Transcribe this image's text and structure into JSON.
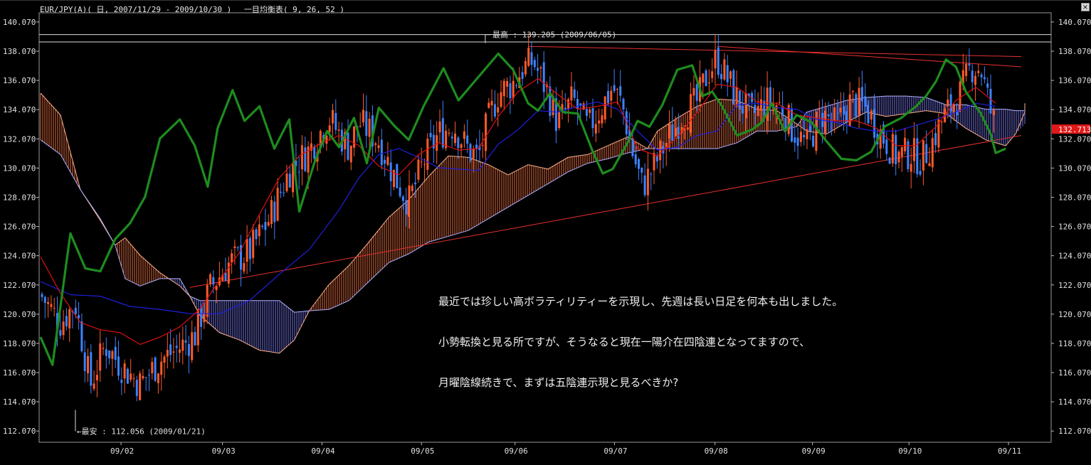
{
  "window": {
    "title": "EUR/JPY(A)( 日, 2007/11/29 - 2009/10/30 )　 一目均衡表( 9, 26, 52 )",
    "close_label": "×"
  },
  "chart_data": {
    "type": "candlestick",
    "symbol": "EUR/JPY(A)",
    "timeframe": "日",
    "period": "2007/11/29 - 2009/10/30",
    "indicator": "一目均衡表( 9, 26, 52 )",
    "ylim": [
      111.4,
      140.6
    ],
    "y_ticks": [
      "140.070",
      "138.070",
      "136.070",
      "134.070",
      "132.070",
      "130.070",
      "128.070",
      "126.070",
      "124.070",
      "122.070",
      "120.070",
      "118.070",
      "116.070",
      "114.070",
      "112.070"
    ],
    "x_ticks": [
      "09/02",
      "09/03",
      "09/04",
      "09/05",
      "09/06",
      "09/07",
      "09/08",
      "09/09",
      "09/10",
      "09/11"
    ],
    "x_tick_positions": [
      0.088,
      0.19,
      0.29,
      0.39,
      0.484,
      0.584,
      0.685,
      0.783,
      0.88,
      0.98
    ],
    "current_price": "132.713",
    "high_label": "最高 : 139.205 (2009/06/05)",
    "low_label": "最安 : 112.056 (2009/01/21)",
    "colors": {
      "up_candle": "#ff5a28",
      "down_candle": "#3c82ff",
      "chikou": "#1e8c1e",
      "kijun": "#2020e0",
      "tenkan": "#e01010",
      "cloud_bull": "#ff7a4a",
      "cloud_bear": "#8080ff",
      "trendline": "#e83030",
      "hline": "#dddddd",
      "price_tag": "#e01818"
    },
    "horizontal_lines": [
      139.205,
      138.7
    ],
    "trendlines": [
      {
        "from": [
          0.15,
          121.9
        ],
        "to": [
          1.0,
          132.3
        ]
      },
      {
        "from": [
          0.49,
          138.4
        ],
        "to": [
          1.0,
          137.7
        ]
      },
      {
        "from": [
          0.68,
          138.4
        ],
        "to": [
          1.0,
          137.0
        ]
      }
    ],
    "candle_points": [
      [
        0.0,
        121.4
      ],
      [
        0.02,
        119.5
      ],
      [
        0.035,
        120.8
      ],
      [
        0.05,
        115.2
      ],
      [
        0.065,
        118.0
      ],
      [
        0.08,
        116.6
      ],
      [
        0.1,
        115.3
      ],
      [
        0.12,
        116.9
      ],
      [
        0.14,
        117.8
      ],
      [
        0.155,
        118.6
      ],
      [
        0.17,
        121.8
      ],
      [
        0.19,
        123.6
      ],
      [
        0.21,
        124.3
      ],
      [
        0.23,
        126.6
      ],
      [
        0.25,
        129.9
      ],
      [
        0.27,
        131.3
      ],
      [
        0.29,
        133.5
      ],
      [
        0.3,
        132.4
      ],
      [
        0.31,
        131.5
      ],
      [
        0.32,
        133.2
      ],
      [
        0.33,
        132.6
      ],
      [
        0.34,
        131.9
      ],
      [
        0.355,
        129.6
      ],
      [
        0.37,
        127.7
      ],
      [
        0.385,
        130.5
      ],
      [
        0.4,
        132.4
      ],
      [
        0.415,
        133.0
      ],
      [
        0.43,
        131.3
      ],
      [
        0.44,
        130.8
      ],
      [
        0.45,
        133.3
      ],
      [
        0.46,
        135.2
      ],
      [
        0.475,
        135.9
      ],
      [
        0.485,
        136.9
      ],
      [
        0.495,
        137.4
      ],
      [
        0.51,
        135.2
      ],
      [
        0.52,
        133.1
      ],
      [
        0.535,
        134.8
      ],
      [
        0.55,
        132.8
      ],
      [
        0.56,
        133.8
      ],
      [
        0.575,
        135.6
      ],
      [
        0.585,
        134.3
      ],
      [
        0.595,
        131.1
      ],
      [
        0.605,
        128.8
      ],
      [
        0.615,
        130.0
      ],
      [
        0.63,
        132.0
      ],
      [
        0.645,
        133.7
      ],
      [
        0.66,
        134.6
      ],
      [
        0.67,
        136.5
      ],
      [
        0.68,
        137.6
      ],
      [
        0.69,
        136.2
      ],
      [
        0.7,
        134.8
      ],
      [
        0.715,
        133.6
      ],
      [
        0.73,
        134.6
      ],
      [
        0.745,
        134.3
      ],
      [
        0.755,
        132.8
      ],
      [
        0.77,
        131.6
      ],
      [
        0.785,
        133.8
      ],
      [
        0.8,
        133.0
      ],
      [
        0.815,
        134.7
      ],
      [
        0.83,
        134.1
      ],
      [
        0.845,
        132.4
      ],
      [
        0.86,
        130.9
      ],
      [
        0.875,
        131.1
      ],
      [
        0.885,
        130.6
      ],
      [
        0.895,
        131.7
      ],
      [
        0.905,
        133.2
      ],
      [
        0.915,
        134.3
      ],
      [
        0.925,
        135.2
      ],
      [
        0.935,
        137.0
      ],
      [
        0.945,
        136.9
      ],
      [
        0.955,
        133.9
      ],
      [
        0.96,
        132.9
      ]
    ],
    "chikou_points": [
      [
        0.0,
        118.5
      ],
      [
        0.012,
        116.6
      ],
      [
        0.03,
        125.6
      ],
      [
        0.045,
        123.2
      ],
      [
        0.06,
        123.0
      ],
      [
        0.075,
        125.2
      ],
      [
        0.09,
        126.3
      ],
      [
        0.105,
        128.1
      ],
      [
        0.12,
        132.1
      ],
      [
        0.14,
        133.4
      ],
      [
        0.155,
        131.6
      ],
      [
        0.168,
        128.8
      ],
      [
        0.178,
        132.8
      ],
      [
        0.193,
        135.4
      ],
      [
        0.205,
        133.3
      ],
      [
        0.22,
        134.3
      ],
      [
        0.235,
        131.4
      ],
      [
        0.25,
        133.4
      ],
      [
        0.26,
        127.1
      ],
      [
        0.275,
        130.4
      ],
      [
        0.288,
        132.6
      ],
      [
        0.3,
        131.5
      ],
      [
        0.315,
        133.5
      ],
      [
        0.328,
        130.4
      ],
      [
        0.34,
        134.2
      ],
      [
        0.355,
        133.0
      ],
      [
        0.37,
        132.0
      ],
      [
        0.385,
        134.3
      ],
      [
        0.405,
        136.9
      ],
      [
        0.42,
        134.7
      ],
      [
        0.44,
        136.3
      ],
      [
        0.46,
        137.9
      ],
      [
        0.475,
        136.8
      ],
      [
        0.49,
        134.5
      ],
      [
        0.5,
        134.0
      ],
      [
        0.512,
        135.2
      ],
      [
        0.525,
        133.9
      ],
      [
        0.54,
        133.8
      ],
      [
        0.555,
        131.2
      ],
      [
        0.565,
        129.7
      ],
      [
        0.575,
        130.0
      ],
      [
        0.59,
        131.8
      ],
      [
        0.6,
        133.3
      ],
      [
        0.612,
        132.9
      ],
      [
        0.625,
        134.4
      ],
      [
        0.64,
        136.8
      ],
      [
        0.655,
        137.1
      ],
      [
        0.665,
        135.0
      ],
      [
        0.675,
        135.3
      ],
      [
        0.685,
        134.3
      ],
      [
        0.7,
        132.3
      ],
      [
        0.715,
        132.7
      ],
      [
        0.725,
        133.2
      ],
      [
        0.735,
        134.5
      ],
      [
        0.748,
        132.6
      ],
      [
        0.76,
        133.7
      ],
      [
        0.775,
        133.2
      ],
      [
        0.79,
        131.9
      ],
      [
        0.805,
        130.7
      ],
      [
        0.82,
        130.6
      ],
      [
        0.835,
        131.2
      ],
      [
        0.848,
        132.9
      ],
      [
        0.865,
        133.5
      ],
      [
        0.88,
        134.3
      ],
      [
        0.89,
        135.0
      ],
      [
        0.9,
        136.0
      ],
      [
        0.91,
        137.5
      ],
      [
        0.92,
        137.0
      ],
      [
        0.93,
        135.3
      ],
      [
        0.945,
        133.8
      ],
      [
        0.955,
        132.4
      ],
      [
        0.96,
        131.1
      ],
      [
        0.97,
        131.4
      ]
    ],
    "kijun_points": [
      [
        0.0,
        122.3
      ],
      [
        0.03,
        121.4
      ],
      [
        0.06,
        121.3
      ],
      [
        0.09,
        120.6
      ],
      [
        0.12,
        120.4
      ],
      [
        0.15,
        120.1
      ],
      [
        0.18,
        120.1
      ],
      [
        0.21,
        121.0
      ],
      [
        0.24,
        122.8
      ],
      [
        0.27,
        124.5
      ],
      [
        0.3,
        127.2
      ],
      [
        0.32,
        129.4
      ],
      [
        0.34,
        131.0
      ],
      [
        0.36,
        131.4
      ],
      [
        0.38,
        130.8
      ],
      [
        0.4,
        130.1
      ],
      [
        0.42,
        130.0
      ],
      [
        0.44,
        129.9
      ],
      [
        0.46,
        131.7
      ],
      [
        0.48,
        132.7
      ],
      [
        0.5,
        134.0
      ],
      [
        0.52,
        133.9
      ],
      [
        0.54,
        134.3
      ],
      [
        0.56,
        134.6
      ],
      [
        0.58,
        134.1
      ],
      [
        0.6,
        132.6
      ],
      [
        0.62,
        131.3
      ],
      [
        0.64,
        131.5
      ],
      [
        0.66,
        132.3
      ],
      [
        0.68,
        132.6
      ],
      [
        0.7,
        134.4
      ],
      [
        0.72,
        134.5
      ],
      [
        0.74,
        134.2
      ],
      [
        0.76,
        134.1
      ],
      [
        0.78,
        133.4
      ],
      [
        0.8,
        133.2
      ],
      [
        0.82,
        132.8
      ],
      [
        0.84,
        132.6
      ],
      [
        0.86,
        132.6
      ],
      [
        0.88,
        133.0
      ],
      [
        0.9,
        133.4
      ],
      [
        0.92,
        133.9
      ],
      [
        0.94,
        134.5
      ],
      [
        0.96,
        134.3
      ]
    ],
    "tenkan_points": [
      [
        0.0,
        124.0
      ],
      [
        0.02,
        121.5
      ],
      [
        0.04,
        119.5
      ],
      [
        0.06,
        119.0
      ],
      [
        0.08,
        118.8
      ],
      [
        0.1,
        118.0
      ],
      [
        0.12,
        118.5
      ],
      [
        0.14,
        119.2
      ],
      [
        0.16,
        120.4
      ],
      [
        0.18,
        122.4
      ],
      [
        0.2,
        124.3
      ],
      [
        0.22,
        126.9
      ],
      [
        0.24,
        129.4
      ],
      [
        0.26,
        130.9
      ],
      [
        0.28,
        131.7
      ],
      [
        0.3,
        132.3
      ],
      [
        0.32,
        131.6
      ],
      [
        0.34,
        130.2
      ],
      [
        0.36,
        129.6
      ],
      [
        0.38,
        131.0
      ],
      [
        0.4,
        131.8
      ],
      [
        0.42,
        131.3
      ],
      [
        0.44,
        131.4
      ],
      [
        0.46,
        133.6
      ],
      [
        0.48,
        135.3
      ],
      [
        0.5,
        136.2
      ],
      [
        0.52,
        135.1
      ],
      [
        0.54,
        134.1
      ],
      [
        0.56,
        134.3
      ],
      [
        0.58,
        134.6
      ],
      [
        0.6,
        131.4
      ],
      [
        0.62,
        130.9
      ],
      [
        0.64,
        132.2
      ],
      [
        0.66,
        133.9
      ],
      [
        0.68,
        135.8
      ],
      [
        0.7,
        135.6
      ],
      [
        0.72,
        134.6
      ],
      [
        0.74,
        134.5
      ],
      [
        0.76,
        133.7
      ],
      [
        0.78,
        133.5
      ],
      [
        0.8,
        133.3
      ],
      [
        0.82,
        133.3
      ],
      [
        0.84,
        132.8
      ],
      [
        0.86,
        131.6
      ],
      [
        0.88,
        131.6
      ],
      [
        0.9,
        132.9
      ],
      [
        0.92,
        134.7
      ],
      [
        0.94,
        135.6
      ],
      [
        0.96,
        134.5
      ]
    ],
    "cloud": [
      {
        "x": 0.0,
        "a": 135.2,
        "b": 132.0
      },
      {
        "x": 0.02,
        "a": 133.7,
        "b": 131.0
      },
      {
        "x": 0.04,
        "a": 128.6,
        "b": 128.6
      },
      {
        "x": 0.06,
        "a": 126.5,
        "b": 126.6
      },
      {
        "x": 0.075,
        "a": 124.8,
        "b": 124.8
      },
      {
        "x": 0.085,
        "a": 125.3,
        "b": 122.5
      },
      {
        "x": 0.1,
        "a": 124.1,
        "b": 122.0
      },
      {
        "x": 0.12,
        "a": 122.9,
        "b": 122.5
      },
      {
        "x": 0.14,
        "a": 122.0,
        "b": 122.5
      },
      {
        "x": 0.15,
        "a": 121.3,
        "b": 121.3
      },
      {
        "x": 0.16,
        "a": 120.0,
        "b": 121.0
      },
      {
        "x": 0.18,
        "a": 118.8,
        "b": 121.0
      },
      {
        "x": 0.2,
        "a": 118.3,
        "b": 121.0
      },
      {
        "x": 0.22,
        "a": 117.6,
        "b": 121.0
      },
      {
        "x": 0.24,
        "a": 117.4,
        "b": 121.0
      },
      {
        "x": 0.255,
        "a": 118.3,
        "b": 120.2
      },
      {
        "x": 0.27,
        "a": 120.3,
        "b": 120.3
      },
      {
        "x": 0.29,
        "a": 122.1,
        "b": 120.4
      },
      {
        "x": 0.31,
        "a": 123.4,
        "b": 121.0
      },
      {
        "x": 0.33,
        "a": 125.0,
        "b": 122.3
      },
      {
        "x": 0.35,
        "a": 126.7,
        "b": 123.6
      },
      {
        "x": 0.37,
        "a": 127.9,
        "b": 124.2
      },
      {
        "x": 0.39,
        "a": 129.5,
        "b": 125.0
      },
      {
        "x": 0.41,
        "a": 130.9,
        "b": 125.4
      },
      {
        "x": 0.43,
        "a": 130.8,
        "b": 125.8
      },
      {
        "x": 0.45,
        "a": 130.3,
        "b": 126.6
      },
      {
        "x": 0.47,
        "a": 129.6,
        "b": 127.4
      },
      {
        "x": 0.49,
        "a": 130.3,
        "b": 128.2
      },
      {
        "x": 0.51,
        "a": 130.0,
        "b": 129.0
      },
      {
        "x": 0.53,
        "a": 130.8,
        "b": 129.8
      },
      {
        "x": 0.55,
        "a": 131.0,
        "b": 130.4
      },
      {
        "x": 0.57,
        "a": 131.6,
        "b": 130.7
      },
      {
        "x": 0.59,
        "a": 132.2,
        "b": 131.1
      },
      {
        "x": 0.61,
        "a": 131.4,
        "b": 131.4
      },
      {
        "x": 0.62,
        "a": 132.6,
        "b": 131.4
      },
      {
        "x": 0.64,
        "a": 133.5,
        "b": 131.4
      },
      {
        "x": 0.66,
        "a": 134.3,
        "b": 131.4
      },
      {
        "x": 0.68,
        "a": 134.8,
        "b": 131.4
      },
      {
        "x": 0.7,
        "a": 134.7,
        "b": 131.8
      },
      {
        "x": 0.72,
        "a": 134.1,
        "b": 132.6
      },
      {
        "x": 0.74,
        "a": 134.0,
        "b": 132.6
      },
      {
        "x": 0.76,
        "a": 133.1,
        "b": 132.9
      },
      {
        "x": 0.77,
        "a": 132.6,
        "b": 133.9
      },
      {
        "x": 0.79,
        "a": 132.4,
        "b": 134.3
      },
      {
        "x": 0.81,
        "a": 133.2,
        "b": 134.7
      },
      {
        "x": 0.83,
        "a": 133.9,
        "b": 134.9
      },
      {
        "x": 0.85,
        "a": 133.6,
        "b": 135.0
      },
      {
        "x": 0.87,
        "a": 133.8,
        "b": 135.0
      },
      {
        "x": 0.89,
        "a": 134.0,
        "b": 134.9
      },
      {
        "x": 0.91,
        "a": 133.8,
        "b": 134.4
      },
      {
        "x": 0.93,
        "a": 132.8,
        "b": 134.4
      },
      {
        "x": 0.95,
        "a": 132.0,
        "b": 134.1
      },
      {
        "x": 0.97,
        "a": 131.6,
        "b": 134.1
      },
      {
        "x": 0.98,
        "a": 132.4,
        "b": 134.0
      },
      {
        "x": 1.0,
        "a": 133.9,
        "b": 134.0
      },
      {
        "x": 1.02,
        "a": 134.5,
        "b": 134.1
      },
      {
        "x": 1.04,
        "a": 134.5,
        "b": 134.1
      }
    ]
  },
  "annotation": {
    "line1": "最近では珍しい高ボラティリティーを示現し、先週は長い日足を何本も出しました。",
    "line2": "小勢転換と見る所ですが、そうなると現在一陽介在四陰連となってますので、",
    "line3": "月曜陰線続きで、まずは五陰連示現と見るべきか?"
  }
}
